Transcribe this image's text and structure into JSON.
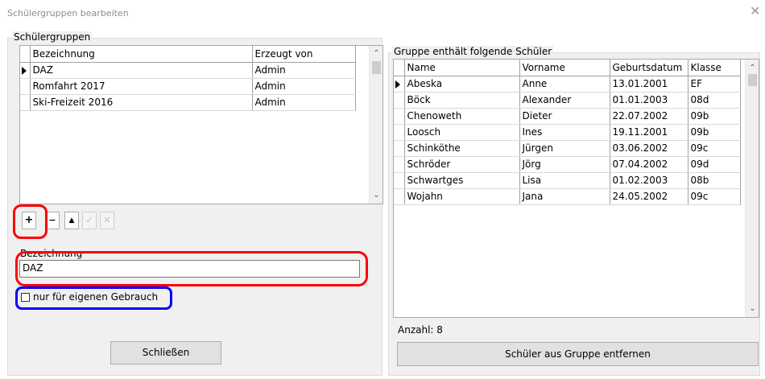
{
  "window": {
    "title": "Schülergruppen bearbeiten",
    "close_glyph": "✕"
  },
  "groups_panel": {
    "title": "Schülergruppen",
    "columns": [
      "Bezeichnung",
      "Erzeugt von"
    ],
    "rows": [
      {
        "name": "DAZ",
        "creator": "Admin",
        "selected": true
      },
      {
        "name": "Romfahrt 2017",
        "creator": "Admin"
      },
      {
        "name": "Ski-Freizeit 2016",
        "creator": "Admin"
      }
    ],
    "toolbar": {
      "add": "+",
      "remove": "−",
      "up": "▲",
      "confirm": "✓",
      "cancel": "✕"
    },
    "name_label": "Bezeichnung",
    "name_value": "DAZ",
    "private_checkbox_label": "nur für eigenen Gebrauch",
    "private_checked": false,
    "close_button": "Schließen"
  },
  "members_panel": {
    "title": "Gruppe enthält folgende Schüler",
    "columns": [
      "Name",
      "Vorname",
      "Geburtsdatum",
      "Klasse"
    ],
    "rows": [
      {
        "name": "Abeska",
        "vorname": "Anne",
        "geburtsdatum": "13.01.2001",
        "klasse": "EF",
        "selected": true
      },
      {
        "name": "Böck",
        "vorname": "Alexander",
        "geburtsdatum": "01.01.2003",
        "klasse": "08d"
      },
      {
        "name": "Chenoweth",
        "vorname": "Dieter",
        "geburtsdatum": "22.07.2002",
        "klasse": "09b"
      },
      {
        "name": "Loosch",
        "vorname": "Ines",
        "geburtsdatum": "19.11.2001",
        "klasse": "09b"
      },
      {
        "name": "Schinköthe",
        "vorname": "Jürgen",
        "geburtsdatum": "03.06.2002",
        "klasse": "09c"
      },
      {
        "name": "Schröder",
        "vorname": "Jörg",
        "geburtsdatum": "07.04.2002",
        "klasse": "09d"
      },
      {
        "name": "Schwartges",
        "vorname": "Lisa",
        "geburtsdatum": "01.02.2003",
        "klasse": "08b"
      },
      {
        "name": "Wojahn",
        "vorname": "Jana",
        "geburtsdatum": "24.05.2002",
        "klasse": "09c"
      }
    ],
    "count_label": "Anzahl: 8",
    "remove_button": "Schüler aus Gruppe entfernen"
  },
  "highlights": {
    "red": "#ff0000",
    "blue": "#0000ff"
  }
}
